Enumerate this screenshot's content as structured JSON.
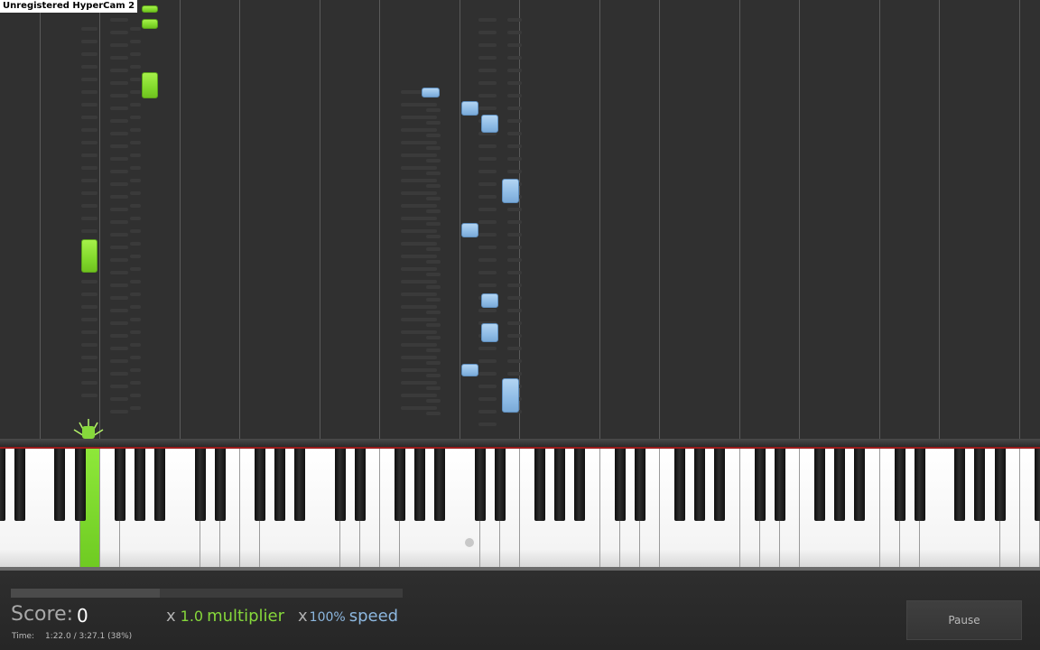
{
  "watermark": "Unregistered HyperCam 2",
  "colors": {
    "background": "#303030",
    "left_hand_notes": "#86d83b",
    "right_hand_notes": "#8fbce6",
    "keyboard_rail": "#9c1c1c"
  },
  "hud": {
    "score_label": "Score:",
    "score_value": "0",
    "time_label": "Time:",
    "time_value": "1:22.0 / 3:27.1 (38%)",
    "song_progress": 0.38,
    "multiplier_x": "x",
    "multiplier_value": "1.0",
    "multiplier_word": "multiplier",
    "speed_x": "x",
    "speed_value": "100%",
    "speed_word": "speed",
    "pause_label": "Pause"
  },
  "notes": {
    "left_hand_color": "green",
    "right_hand_color": "blue",
    "pressed_key_color": "green"
  }
}
